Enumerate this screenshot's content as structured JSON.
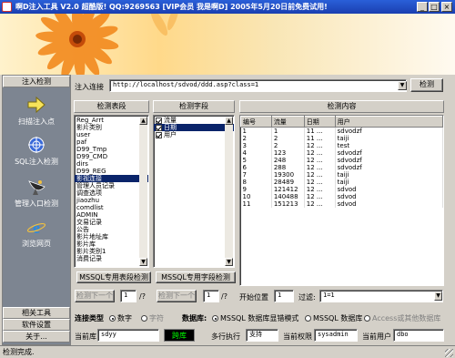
{
  "window": {
    "title": "啊D注入工具 V2.0   超酷版! QQ:9269563 [VIP会员 我是啊D] 2005年5月20日前免费试用!"
  },
  "sidebar": {
    "tab_top": "注入检测",
    "items": [
      {
        "label": "扫描注入点",
        "icon": "arrow-right-icon"
      },
      {
        "label": "SQL注入检测",
        "icon": "crosshair-icon"
      },
      {
        "label": "管理入口检测",
        "icon": "satellite-dish-icon"
      },
      {
        "label": "浏览网页",
        "icon": "ie-browser-icon"
      }
    ],
    "bottom_tabs": [
      "相关工具",
      "软件设置",
      "关于..."
    ]
  },
  "url_bar": {
    "label": "注入连接",
    "value": "http://localhost/sdvod/ddd.asp?class=1",
    "detect_button": "检测"
  },
  "tables_panel": {
    "header": "检测表段",
    "items": [
      "Reg_Arrt",
      "影片类别",
      "user",
      "paf",
      "D99_Tmp",
      "D99_CMD",
      "dirs",
      "D99_REG",
      "影视连接",
      "管理人员记录",
      "调查选项",
      "jiaozhu",
      "comdlist",
      "ADMIN",
      "交易记录",
      "公告",
      "影片地址库",
      "影片库",
      "影片类别1",
      "消费记录"
    ],
    "selected_index": 8,
    "button": "MSSQL专用表段检测"
  },
  "fields_panel": {
    "header": "检测字段",
    "items": [
      "流量",
      "日期",
      "用户"
    ],
    "selected_index": 1,
    "button": "MSSQL专用字段检测"
  },
  "content_panel": {
    "header": "检测内容",
    "columns": [
      "编号",
      "流量",
      "日期",
      "用户"
    ],
    "rows": [
      [
        "1",
        "1",
        "11 ...",
        "sdvodzf"
      ],
      [
        "2",
        "2",
        "11 ...",
        "taiji"
      ],
      [
        "3",
        "2",
        "12 ...",
        "test"
      ],
      [
        "4",
        "123",
        "12 ...",
        "sdvodzf"
      ],
      [
        "5",
        "248",
        "12 ...",
        "sdvodzf"
      ],
      [
        "6",
        "288",
        "12 ...",
        "sdvodzf"
      ],
      [
        "7",
        "19300",
        "12 ...",
        "taiji"
      ],
      [
        "8",
        "28489",
        "12 ...",
        "taiji"
      ],
      [
        "9",
        "121412",
        "12 ...",
        "sdvod"
      ],
      [
        "10",
        "140488",
        "12 ...",
        "sdvod"
      ],
      [
        "11",
        "151213",
        "12 ...",
        "sdvod"
      ]
    ]
  },
  "pager": {
    "next1": "检测下一个",
    "page1": "1",
    "of1": "/?",
    "next2": "检测下一个",
    "page2": "1",
    "of2": "/?",
    "start_label": "开始位置",
    "start_value": "1",
    "filter_label": "过滤:",
    "filter_value": "1=1"
  },
  "conn_type": {
    "label": "连接类型",
    "options": [
      "数字",
      "字符"
    ],
    "selected": 0
  },
  "db_type": {
    "label": "数据库:",
    "options": [
      "MSSQL 数据库显错模式",
      "MSSQL 数据库",
      "Access或其他数据库"
    ],
    "selected": 0
  },
  "info": {
    "current_db_label": "当前库",
    "current_db_value": "sdyy",
    "bypass_button": "跨库",
    "multi_line_label": "多行执行",
    "multi_line_value": "支持",
    "perm_label": "当前权限",
    "perm_value": "sysadmin",
    "user_label": "当前用户",
    "user_value": "dbo"
  },
  "status": {
    "text": "检测完成."
  },
  "colors": {
    "title_bar": "#1a3fb0",
    "selection": "#0a246a",
    "sidebar_bg": "#7d8591",
    "bypass_bg": "#000000",
    "bypass_fg": "#00ff00"
  }
}
